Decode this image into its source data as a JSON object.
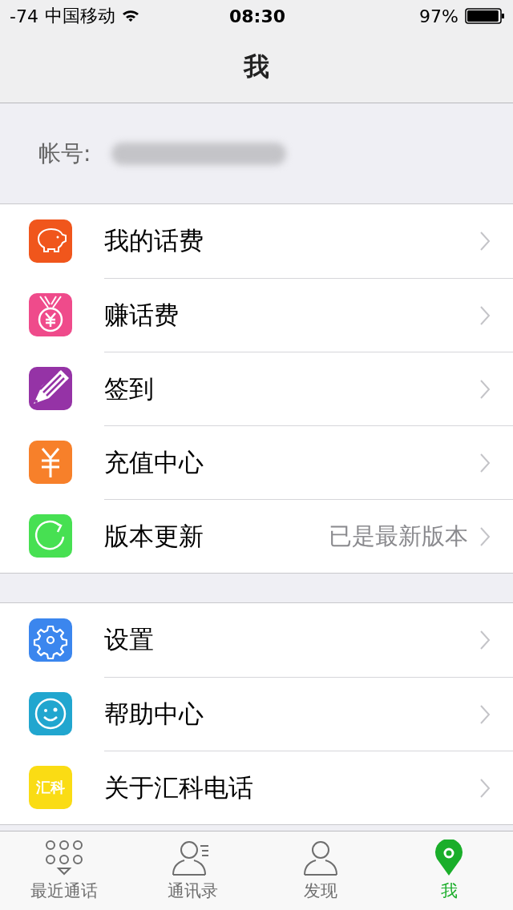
{
  "status_bar": {
    "signal": "-74",
    "carrier": "中国移动",
    "time": "08:30",
    "battery": "97%",
    "level": 0.97
  },
  "nav": {
    "title": "我"
  },
  "account": {
    "label": "帐号:"
  },
  "groups": [
    {
      "items": [
        {
          "kind": "piggy",
          "color": "#f0561c",
          "label": "我的话费"
        },
        {
          "kind": "medal",
          "color": "#ef4b8b",
          "label": "赚话费"
        },
        {
          "kind": "pencil",
          "color": "#9533a6",
          "label": "签到"
        },
        {
          "kind": "yuan",
          "color": "#f7802a",
          "label": "充值中心"
        },
        {
          "kind": "refresh",
          "color": "#47e052",
          "label": "版本更新",
          "detail": "已是最新版本"
        }
      ]
    },
    {
      "items": [
        {
          "kind": "gear",
          "color": "#3b86ee",
          "label": "设置"
        },
        {
          "kind": "smile",
          "color": "#21a6cf",
          "label": "帮助中心"
        },
        {
          "kind": "text",
          "color": "#fadc14",
          "icon_text": "汇科",
          "label": "关于汇科电话"
        }
      ]
    }
  ],
  "tabs": [
    {
      "kind": "dialpad",
      "label": "最近通话",
      "selected": false
    },
    {
      "kind": "contacts",
      "label": "通讯录",
      "selected": false
    },
    {
      "kind": "person",
      "label": "发现",
      "selected": false
    },
    {
      "kind": "pin",
      "label": "我",
      "selected": true
    }
  ]
}
